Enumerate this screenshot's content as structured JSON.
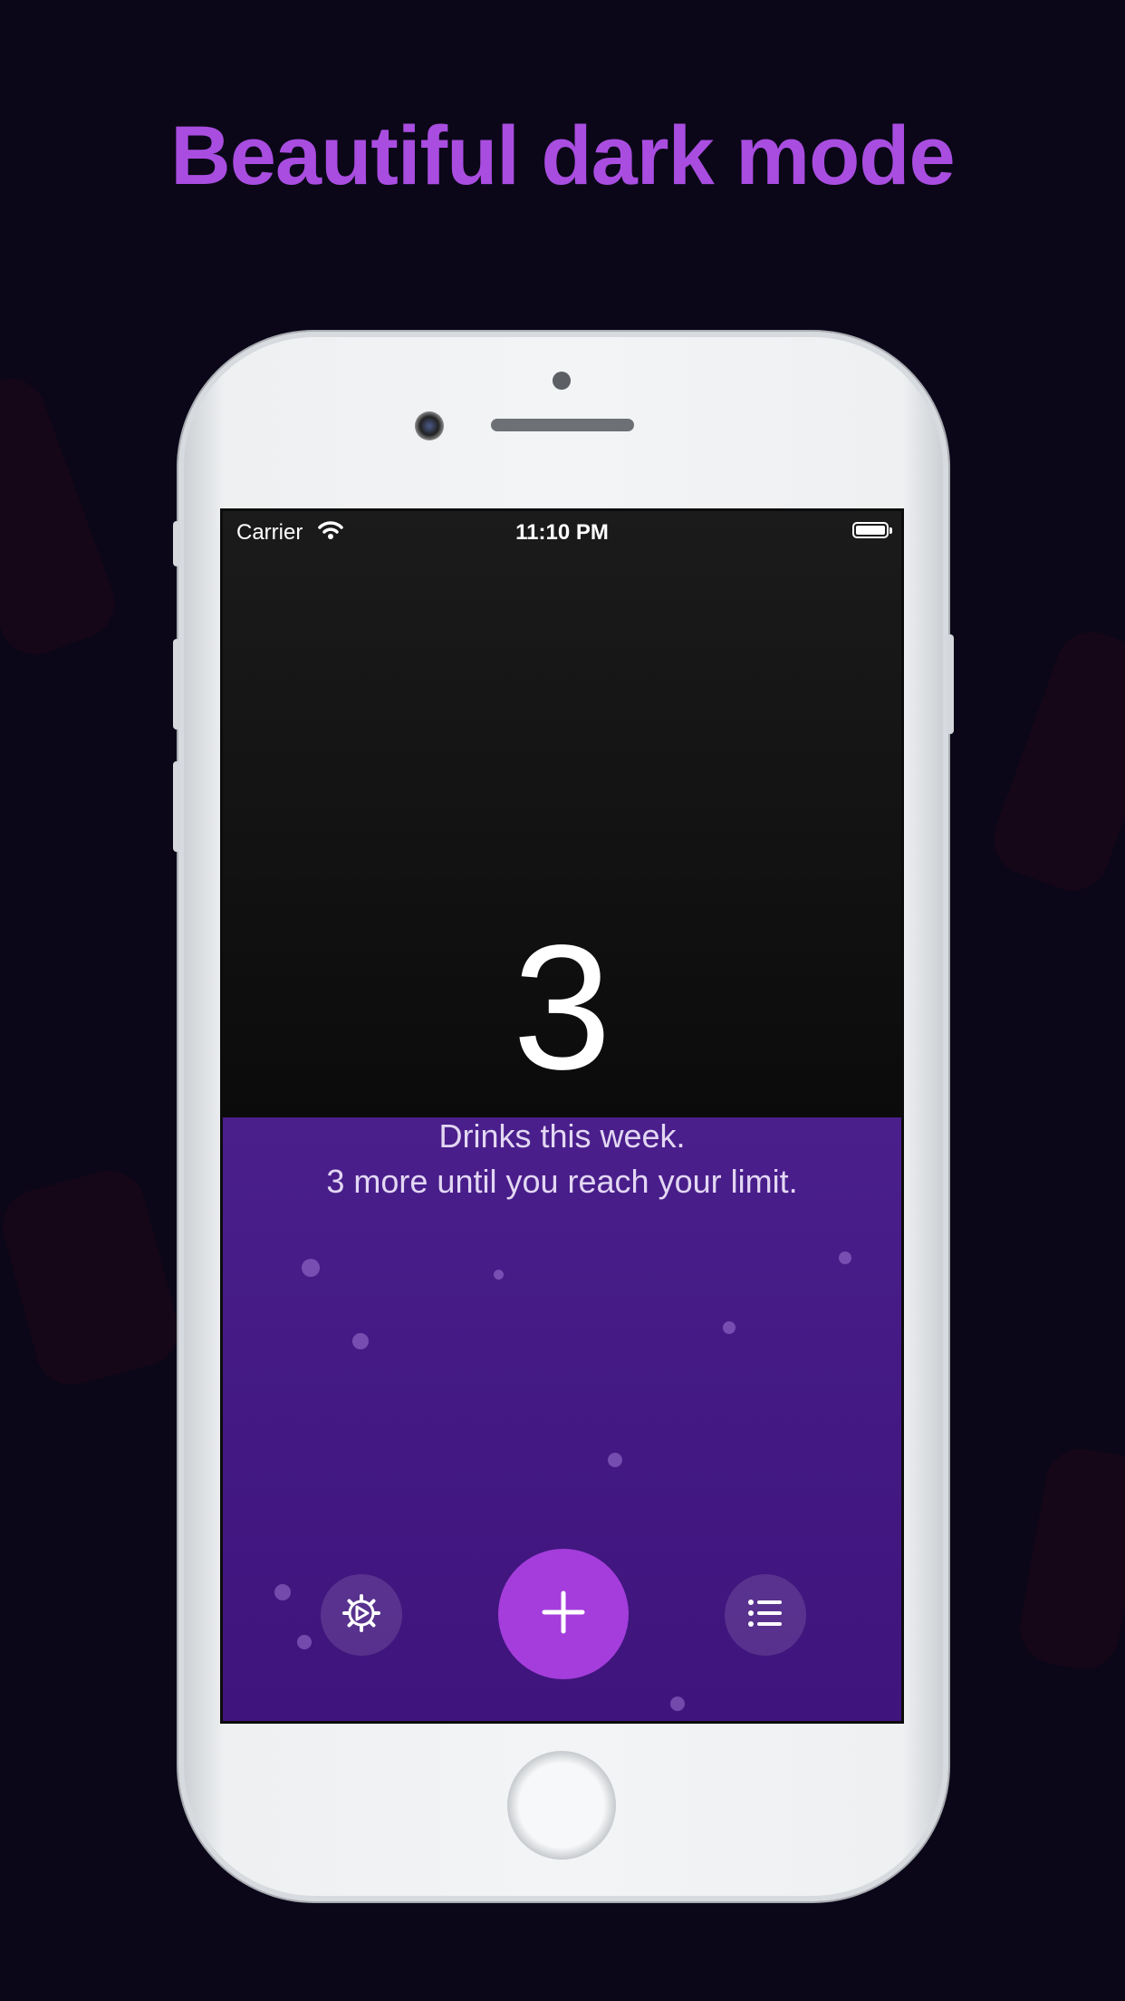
{
  "headline": "Beautiful dark mode",
  "status_bar": {
    "carrier": "Carrier",
    "time": "11:10 PM",
    "battery_level": 1.0,
    "wifi_icon": "wifi-icon",
    "battery_icon": "battery-icon"
  },
  "main": {
    "drink_count": "3",
    "caption_line1": "Drinks this week.",
    "caption_line2": "3 more until you reach your limit."
  },
  "toolbar": {
    "settings_icon": "gear-icon",
    "add_icon": "plus-icon",
    "history_icon": "list-icon"
  },
  "colors": {
    "headline": "#a94de0",
    "accent": "#a43ddb",
    "panel": "#461b86",
    "background": "#0b0719"
  }
}
